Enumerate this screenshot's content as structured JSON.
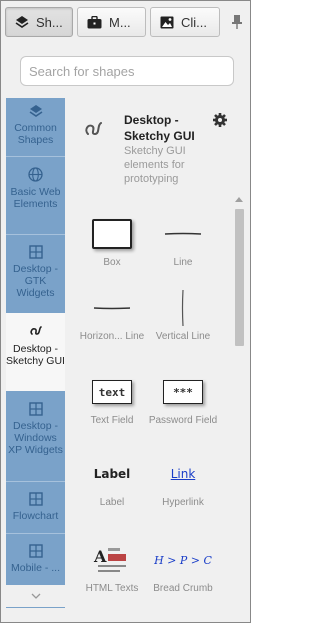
{
  "tabs": [
    {
      "label": "Sh...",
      "icon": "shapes-icon",
      "active": true
    },
    {
      "label": "M...",
      "icon": "briefcase-icon",
      "active": false
    },
    {
      "label": "Cli...",
      "icon": "image-icon",
      "active": false
    }
  ],
  "search": {
    "placeholder": "Search for shapes"
  },
  "libraries": [
    {
      "label": "Common Shapes",
      "icon": "layers-icon"
    },
    {
      "label": "Basic Web Elements",
      "icon": "globe-icon"
    },
    {
      "label": "Desktop - GTK Widgets",
      "icon": "grid-icon"
    },
    {
      "label": "Desktop - Sketchy GUI",
      "icon": "squiggle-icon",
      "active": true
    },
    {
      "label": "Desktop - Windows XP Widgets",
      "icon": "grid-icon"
    },
    {
      "label": "Flowchart",
      "icon": "grid-icon"
    },
    {
      "label": "Mobile - ...",
      "icon": "grid-icon"
    }
  ],
  "selected_library": {
    "title": "Desktop - Sketchy GUI",
    "description": "Sketchy GUI elements for prototyping"
  },
  "shapes": [
    {
      "name": "Box",
      "preview": "box"
    },
    {
      "name": "Line",
      "preview": "hline"
    },
    {
      "name": "Horizon... Line",
      "preview": "hline"
    },
    {
      "name": "Vertical Line",
      "preview": "vline"
    },
    {
      "name": "Text Field",
      "preview": "text",
      "preview_text": "text"
    },
    {
      "name": "Password Field",
      "preview": "password",
      "preview_text": "***"
    },
    {
      "name": "Label",
      "preview": "label",
      "preview_text": "Label"
    },
    {
      "name": "Hyperlink",
      "preview": "link",
      "preview_text": "Link"
    },
    {
      "name": "HTML Texts",
      "preview": "html"
    },
    {
      "name": "Bread Crumb",
      "preview": "crumb",
      "preview_text": "H > P > C"
    }
  ],
  "colors": {
    "sidebar": "#7aa2c9",
    "link": "#1a3ec8"
  }
}
